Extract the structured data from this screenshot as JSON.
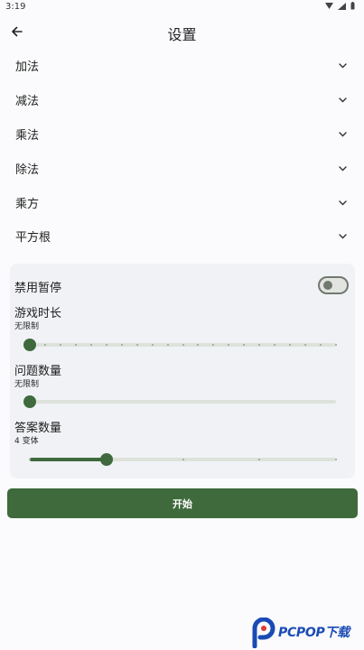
{
  "status_bar": {
    "time": "3:19"
  },
  "app_bar": {
    "title": "设置"
  },
  "categories": [
    {
      "label": "加法"
    },
    {
      "label": "减法"
    },
    {
      "label": "乘法"
    },
    {
      "label": "除法"
    },
    {
      "label": "乘方"
    },
    {
      "label": "平方根"
    }
  ],
  "settings": {
    "disable_pause": {
      "label": "禁用暂停",
      "enabled": false
    },
    "game_duration": {
      "title": "游戏时长",
      "value_text": "无限制",
      "position": 0.0,
      "ticks": 21
    },
    "question_count": {
      "title": "问题数量",
      "value_text": "无限制",
      "position": 0.0
    },
    "answer_count": {
      "title": "答案数量",
      "value_text": "4 变体",
      "position": 0.25,
      "ticks": 5
    }
  },
  "start_button": {
    "label": "开始"
  },
  "watermark": {
    "text": "PCPOP下载"
  },
  "colors": {
    "primary": "#3e6a3c",
    "card_bg": "#f1f2f6",
    "track": "#dde2da",
    "watermark": "#1a4bb5"
  }
}
